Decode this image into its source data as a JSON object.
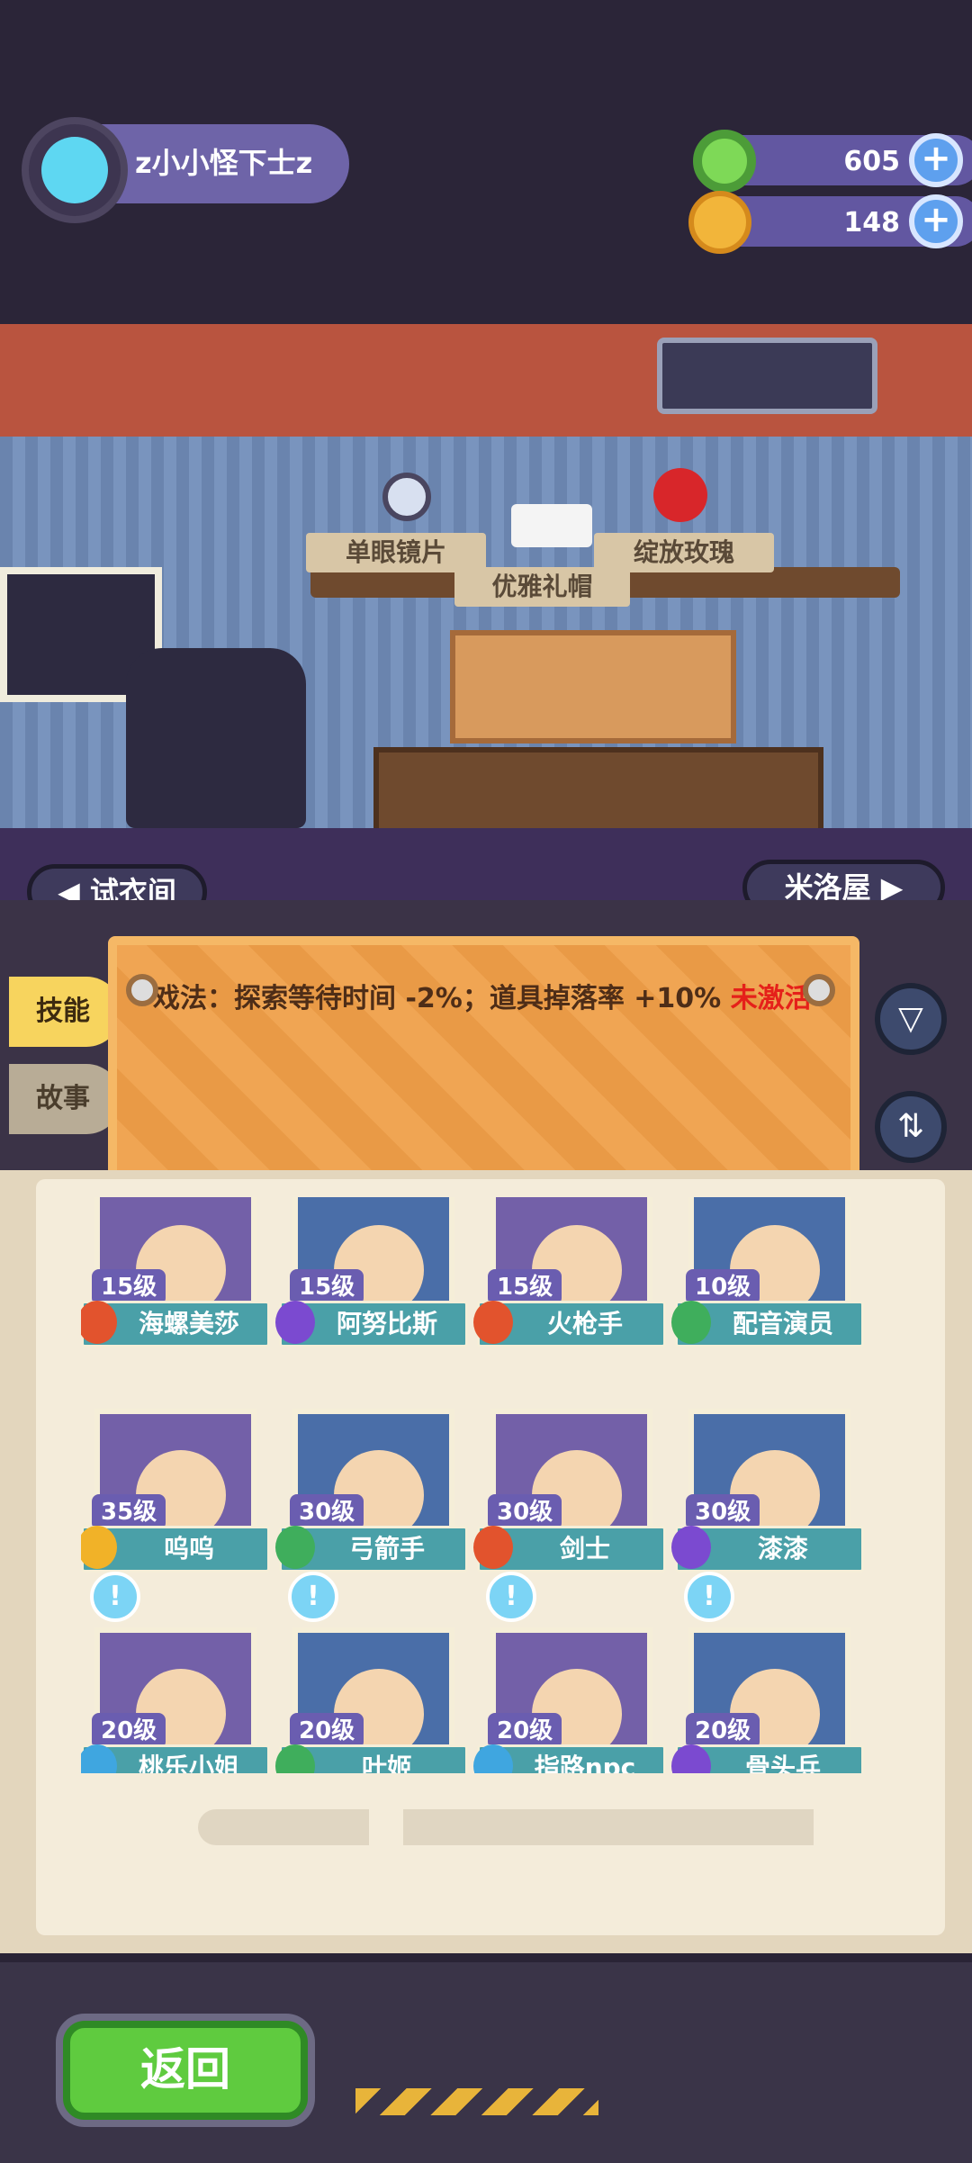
{
  "player": {
    "name": "z小小怪下士z"
  },
  "currency": {
    "donut": {
      "value": "605",
      "color": "#7ed957"
    },
    "planet": {
      "value": "148",
      "color": "#f2b53a"
    }
  },
  "plus_label": "+",
  "display": {
    "items": [
      "单眼镜片",
      "优雅礼帽",
      "绽放玫瑰"
    ]
  },
  "nav": {
    "left": "◀ 试衣间",
    "right": "米洛屋 ▶"
  },
  "tabs": {
    "skill": "技能",
    "story": "故事"
  },
  "notice": {
    "text": "戏法：探索等待时间 -2%；道具掉落率 +10% ",
    "status": "未激活"
  },
  "filter_icon": "filter-icon",
  "sort_icon": "sort-icon",
  "characters": [
    {
      "level": "15级",
      "name": "海螺美莎",
      "badge": "#e2532d"
    },
    {
      "level": "15级",
      "name": "阿努比斯",
      "badge": "#7b4ad0"
    },
    {
      "level": "15级",
      "name": "火枪手",
      "badge": "#e2532d"
    },
    {
      "level": "10级",
      "name": "配音演员",
      "badge": "#3fae5c"
    },
    {
      "level": "35级",
      "name": "呜呜",
      "badge": "#f1b228"
    },
    {
      "level": "30级",
      "name": "弓箭手",
      "badge": "#3fae5c"
    },
    {
      "level": "30级",
      "name": "剑士",
      "badge": "#e2532d"
    },
    {
      "level": "30级",
      "name": "漆漆",
      "badge": "#7b4ad0"
    },
    {
      "level": "20级",
      "name": "桃乐小姐",
      "badge": "#3fa6e0",
      "alert": "!"
    },
    {
      "level": "20级",
      "name": "叶姬",
      "badge": "#3fae5c",
      "alert": "!"
    },
    {
      "level": "20级",
      "name": "指路npc",
      "badge": "#3fa6e0",
      "alert": "!"
    },
    {
      "level": "20级",
      "name": "骨头兵",
      "badge": "#7b4ad0",
      "alert": "!"
    }
  ],
  "back_button": "返回"
}
